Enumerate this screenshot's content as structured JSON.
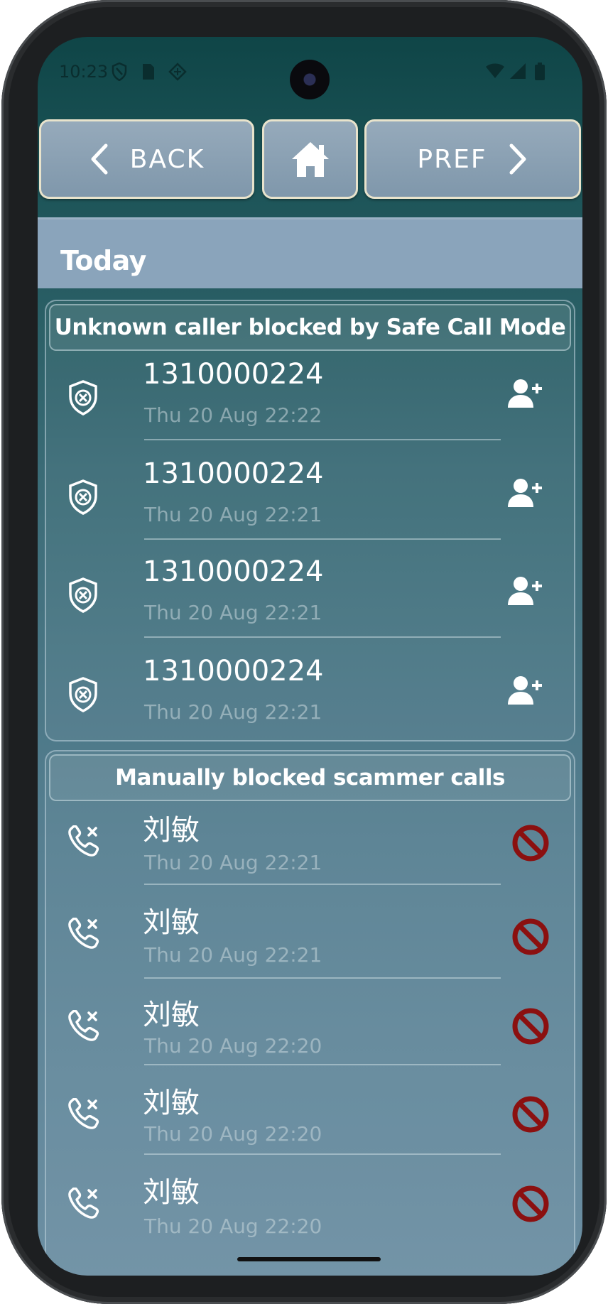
{
  "status_bar": {
    "time": "10:23",
    "icons": [
      "shield-icon",
      "sim-card-icon",
      "data-saver-icon",
      "wifi-icon",
      "cell-signal-icon",
      "battery-icon"
    ]
  },
  "nav": {
    "back_label": "BACK",
    "home_icon": "home-icon",
    "pref_label": "PREF"
  },
  "day_header": "Today",
  "unknown_section": {
    "title": "Unknown caller blocked by Safe Call Mode",
    "items": [
      {
        "number": "1310000224",
        "time": "Thu 20 Aug 22:22"
      },
      {
        "number": "1310000224",
        "time": "Thu 20 Aug 22:21"
      },
      {
        "number": "1310000224",
        "time": "Thu 20 Aug 22:21"
      },
      {
        "number": "1310000224",
        "time": "Thu 20 Aug 22:21"
      }
    ]
  },
  "scammer_section": {
    "title": "Manually blocked scammer calls",
    "items": [
      {
        "name": "刘敏",
        "time": "Thu 20 Aug 22:21"
      },
      {
        "name": "刘敏",
        "time": "Thu 20 Aug 22:21"
      },
      {
        "name": "刘敏",
        "time": "Thu 20 Aug 22:20"
      },
      {
        "name": "刘敏",
        "time": "Thu 20 Aug 22:20"
      },
      {
        "name": "刘敏",
        "time": "Thu 20 Aug 22:20"
      }
    ]
  },
  "colors": {
    "nav_button": "#8aa0b4",
    "nav_border": "#e8e3cc",
    "block_red": "#8b1010",
    "header_bar": "#8aa4bb"
  }
}
